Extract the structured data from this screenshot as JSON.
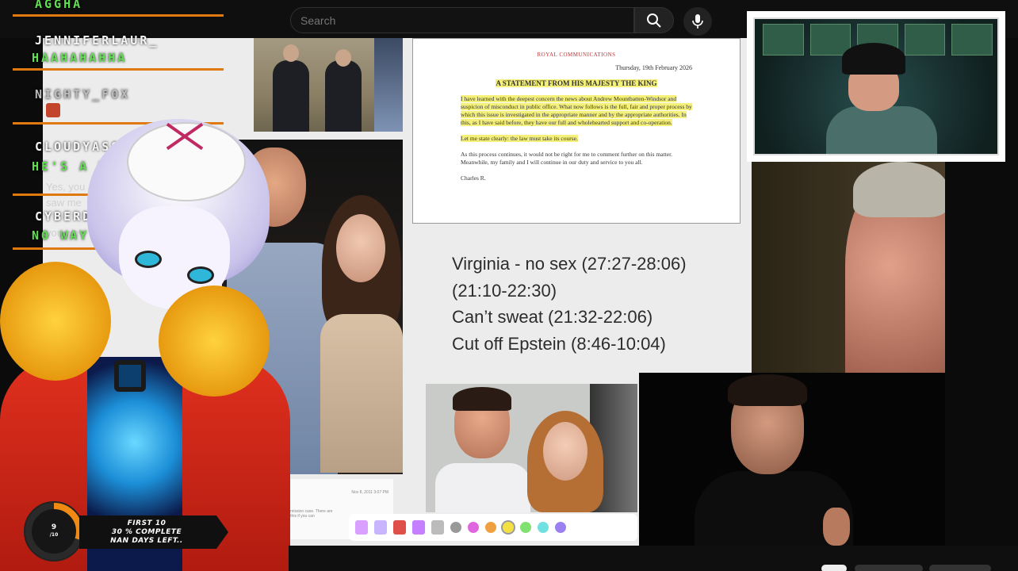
{
  "header": {
    "search_placeholder": "Search"
  },
  "chat": {
    "messages": [
      {
        "user": "",
        "text": "AGGHA"
      },
      {
        "user": "JENNIFERLAUR_",
        "text": "HAAHAHAHHA"
      },
      {
        "user": "NIGHTY_FOX",
        "text": ""
      },
      {
        "user": "CLOUDYASS",
        "text": "HE'S A BASTARD"
      },
      {
        "user": "CYBERDOGGY",
        "text": "NO WAY"
      }
    ],
    "faint_lines": [
      "Yes, you",
      "saw me",
      "you wa",
      "well"
    ]
  },
  "statement": {
    "crest": "ROYAL COMMUNICATIONS",
    "date": "Thursday, 19th February 2026",
    "title": "A STATEMENT FROM HIS MAJESTY THE KING",
    "p1": "I have learned with the deepest concern the news about Andrew Mountbatten-Windsor and suspicion of misconduct in public office. What now follows is the full, fair and proper process by which this issue is investigated in the appropriate manner and by the appropriate authorities. In this, as I have said before, they have our full and wholehearted support and co-operation.",
    "p2": "Let me state clearly: the law must take its course.",
    "p3": "As this process continues, it would not be right for me to comment further on this matter. Meanwhile, my family and I will continue in our duty and service to you all.",
    "signature": "Charles R."
  },
  "timecodes": [
    "Virginia - no sex (27:27-28:06)",
    "(21:10-22:30)",
    "Can’t sweat (21:32-22:06)",
    "Cut off Epstein (8:46-10:04)"
  ],
  "toolbar": {
    "colors": [
      "#999999",
      "#e066e0",
      "#f0a040",
      "#f4e040",
      "#80e070",
      "#70e0e0",
      "#9a80f0"
    ],
    "tool_colors": [
      "#d9a0ff",
      "#c9b4ff",
      "#e0504a",
      "#c580ff"
    ]
  },
  "email": {
    "meta": "Nov 8, 2011 3:07 PM",
    "line1": "...mission case. There are",
    "line2": "...this if you can"
  },
  "goal_widget": {
    "ring_top": "9",
    "ring_bottom": "/10",
    "progress": 0.3,
    "line1": "FIRST 10",
    "line2": "30 % COMPLETE",
    "line3": "NAN DAYS LEFT.."
  },
  "colors": {
    "chat_accent": "#e07a10",
    "chat_msg": "#5fe04f",
    "highlight": "#f4f07a",
    "ring": "#f08a12"
  }
}
